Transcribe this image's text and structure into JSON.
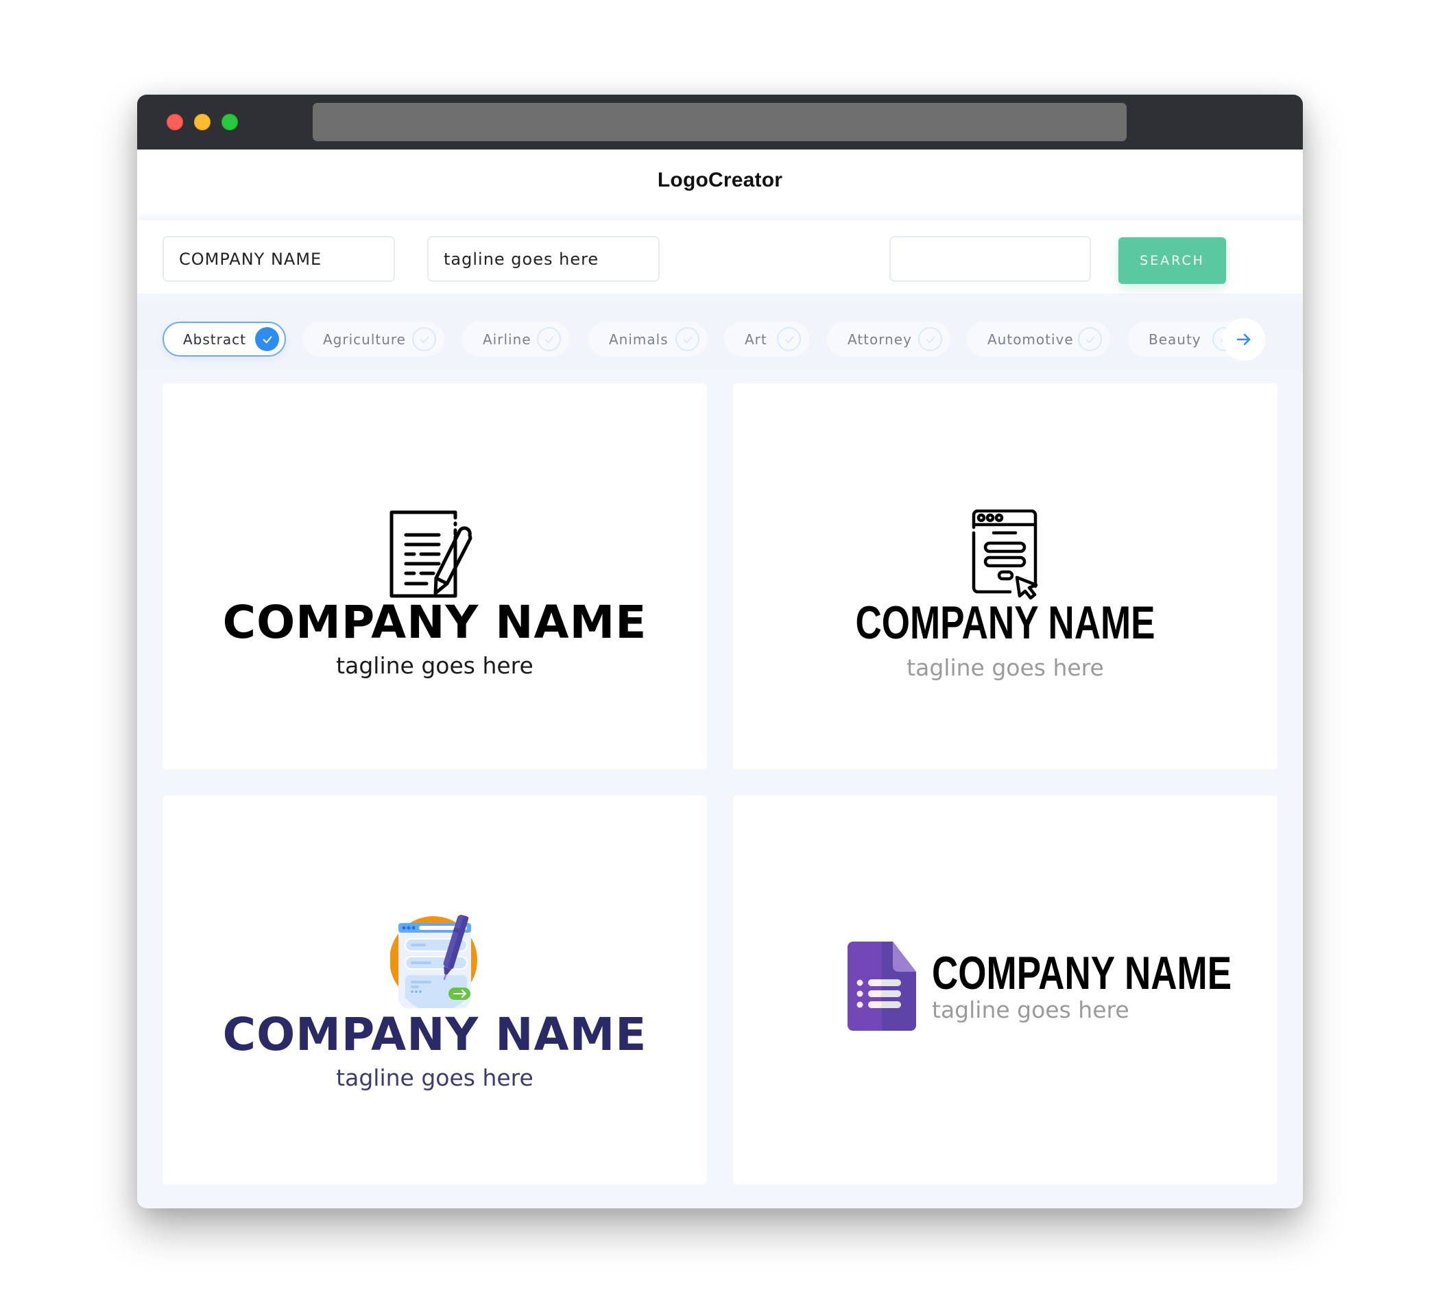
{
  "browser": {
    "window_controls": [
      "close",
      "minimize",
      "maximize"
    ],
    "url": ""
  },
  "header": {
    "title": "LogoCreator"
  },
  "search": {
    "company_name_value": "COMPANY NAME",
    "tagline_value": "tagline goes here",
    "keyword_value": "",
    "button_label": "SEARCH"
  },
  "categories": {
    "items": [
      {
        "label": "Abstract",
        "selected": true
      },
      {
        "label": "Agriculture",
        "selected": false
      },
      {
        "label": "Airline",
        "selected": false
      },
      {
        "label": "Animals",
        "selected": false
      },
      {
        "label": "Art",
        "selected": false
      },
      {
        "label": "Attorney",
        "selected": false
      },
      {
        "label": "Automotive",
        "selected": false
      },
      {
        "label": "Beauty",
        "selected": false
      }
    ],
    "next_icon": "arrow-right-icon"
  },
  "logos": [
    {
      "company": "COMPANY NAME",
      "tagline": "tagline goes here",
      "icon": "document-pencil-icon",
      "color": "#000000"
    },
    {
      "company": "COMPANY NAME",
      "tagline": "tagline goes here",
      "icon": "web-form-cursor-icon",
      "color": "#000000"
    },
    {
      "company": "COMPANY NAME",
      "tagline": "tagline goes here",
      "icon": "online-form-pen-icon",
      "color": "#2b2a66"
    },
    {
      "company": "COMPANY NAME",
      "tagline": "tagline goes here",
      "icon": "form-document-icon",
      "color": "#000000"
    }
  ],
  "colors": {
    "accent_blue": "#2f8df0",
    "search_button": "#5ac9a1",
    "titlebar": "#2f3033",
    "form_purple": "#7248b9"
  }
}
